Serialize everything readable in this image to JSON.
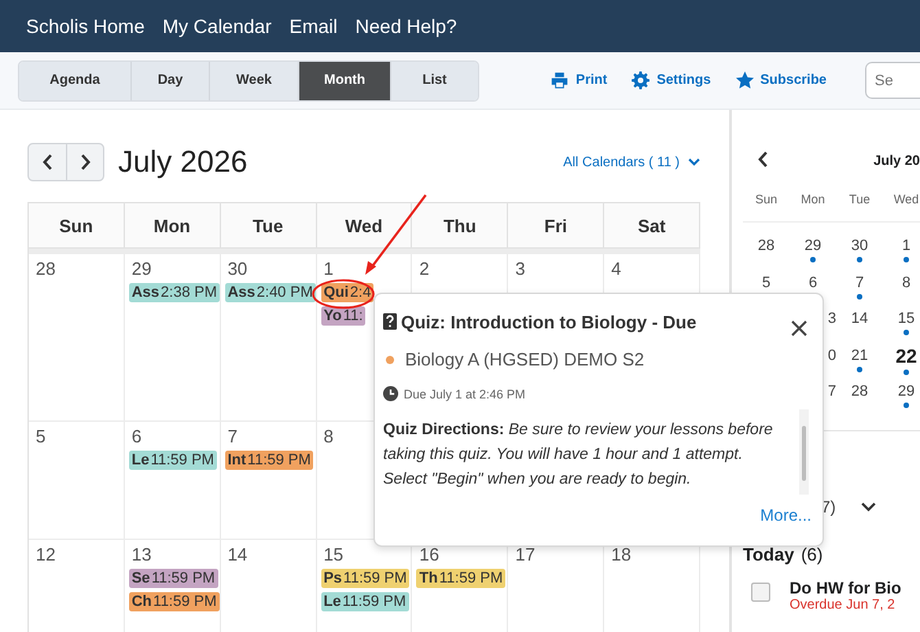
{
  "top_nav": {
    "links": [
      "Scholis Home",
      "My Calendar",
      "Email",
      "Need Help?"
    ]
  },
  "toolbar": {
    "views": [
      {
        "label": "Agenda",
        "selected": false
      },
      {
        "label": "Day",
        "selected": false
      },
      {
        "label": "Week",
        "selected": false
      },
      {
        "label": "Month",
        "selected": true
      },
      {
        "label": "List",
        "selected": false
      }
    ],
    "actions": [
      {
        "kind": "print",
        "label": "Print"
      },
      {
        "kind": "settings",
        "label": "Settings"
      },
      {
        "kind": "subscribe",
        "label": "Subscribe"
      }
    ],
    "search": {
      "placeholder": "Se"
    }
  },
  "month": {
    "title": "July 2026",
    "calendars_filter": "All Calendars ( 11 )",
    "weekdays": [
      "Sun",
      "Mon",
      "Tue",
      "Wed",
      "Thu",
      "Fri",
      "Sat"
    ],
    "weeks": [
      {
        "days": [
          {
            "day": "28"
          },
          {
            "day": "29",
            "events": [
              {
                "title": "Ass",
                "time": "2:38 PM",
                "color": "#a3dbd5"
              }
            ]
          },
          {
            "day": "30",
            "events": [
              {
                "title": "Ass",
                "time": "2:40 PM",
                "color": "#a3dbd5"
              }
            ]
          },
          {
            "day": "1",
            "events": [
              {
                "title": "Qui",
                "time": "2:4",
                "color": "#f0a15f"
              },
              {
                "title": "Yo",
                "time": "11:",
                "color": "#c4a4c2"
              }
            ]
          },
          {
            "day": "2"
          },
          {
            "day": "3"
          },
          {
            "day": "4"
          }
        ]
      },
      {
        "days": [
          {
            "day": "5"
          },
          {
            "day": "6",
            "events": [
              {
                "title": "Le",
                "time": "11:59 PM",
                "color": "#a3dbd5"
              }
            ]
          },
          {
            "day": "7",
            "events": [
              {
                "title": "Int",
                "time": "11:59 PM",
                "color": "#f0a15f"
              }
            ]
          },
          {
            "day": "8"
          }
        ]
      },
      {
        "days": [
          {
            "day": "12"
          },
          {
            "day": "13",
            "events": [
              {
                "title": "Se",
                "time": "11:59 PM",
                "color": "#c4a4c2"
              },
              {
                "title": "Ch",
                "time": "11:59 PM",
                "color": "#f0a15f"
              }
            ]
          },
          {
            "day": "14"
          },
          {
            "day": "15",
            "events": [
              {
                "title": "Ps",
                "time": "11:59 PM",
                "color": "#efd170"
              },
              {
                "title": "Le",
                "time": "11:59 PM",
                "color": "#a3dbd5"
              }
            ]
          },
          {
            "day": "16",
            "events": [
              {
                "title": "Th",
                "time": "11:59 PM",
                "color": "#efd170"
              }
            ]
          },
          {
            "day": "17"
          },
          {
            "day": "18"
          }
        ]
      }
    ]
  },
  "popover": {
    "title": "Quiz: Introduction to Biology - Due",
    "course": "Biology A (HGSED) DEMO S2",
    "due": "Due July 1 at 2:46 PM",
    "directions": "**Quiz Directions:** *Be sure to review your lessons before taking this quiz. You will have 1 hour and 1 attempt. Select \"Begin\" when you are ready to begin.*",
    "more_link": "More..."
  },
  "mini_calendar": {
    "title": "July 20",
    "weekdays": [
      "Sun",
      "Mon",
      "Tue",
      "Wed"
    ],
    "rows": [
      [
        {
          "day": "28",
          "dot": false
        },
        {
          "day": "29",
          "dot": true
        },
        {
          "day": "30",
          "dot": true
        },
        {
          "day": "1",
          "dot": true
        }
      ],
      [
        {
          "day": "5",
          "dot": false
        },
        {
          "day": "6",
          "dot": false
        },
        {
          "day": "7",
          "dot": true
        },
        {
          "day": "8",
          "dot": false
        }
      ],
      [
        {
          "day": "3",
          "dot": false,
          "cut": true
        },
        {
          "day": "14",
          "dot": false
        },
        {
          "day": "15",
          "dot": true
        }
      ],
      [
        {
          "day": "0",
          "dot": false,
          "cut": true
        },
        {
          "day": "21",
          "dot": true
        },
        {
          "day": "22",
          "dot": true,
          "today": true
        }
      ],
      [
        {
          "day": "7",
          "dot": false,
          "cut": true
        },
        {
          "day": "28",
          "dot": false
        },
        {
          "day": "29",
          "dot": true
        }
      ]
    ]
  },
  "tasks": {
    "group_count": "7)",
    "today_label": "Today",
    "today_count": "(6)",
    "items": [
      {
        "title": "Do HW for Bio",
        "status": "Overdue Jun 7, 2",
        "checked": false
      }
    ]
  }
}
